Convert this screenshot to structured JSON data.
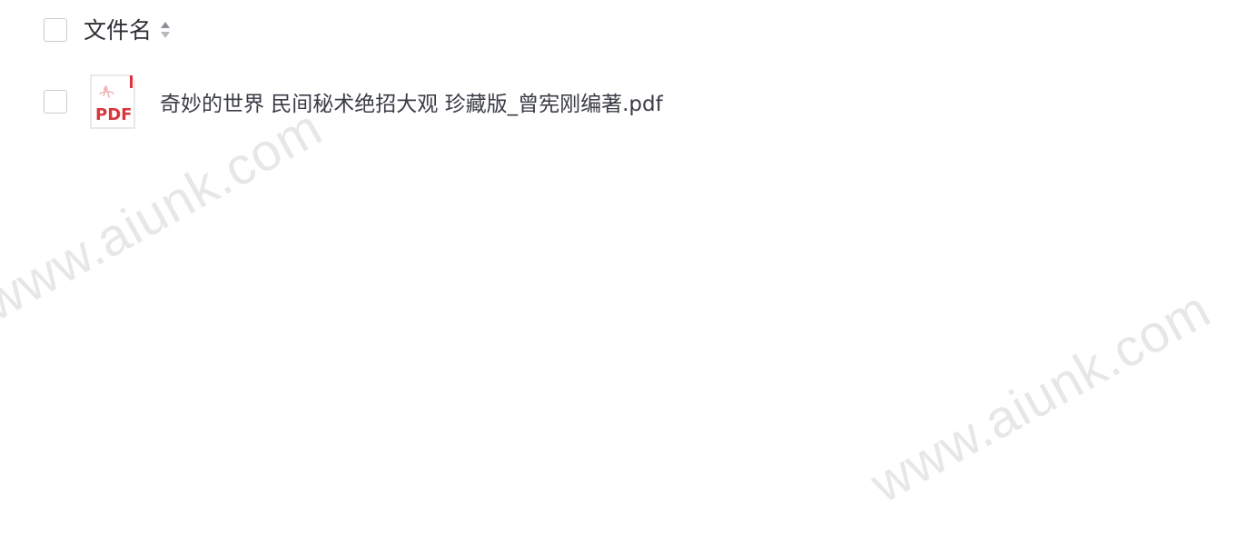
{
  "watermark": {
    "text": "www.aiunk.com"
  },
  "header": {
    "column_label": "文件名"
  },
  "files": [
    {
      "name": "奇妙的世界 民间秘术绝招大观 珍藏版_曾宪刚编著.pdf",
      "type_badge": "PDF"
    }
  ],
  "colors": {
    "pdf_red": "#d9363e",
    "text": "#333340"
  }
}
